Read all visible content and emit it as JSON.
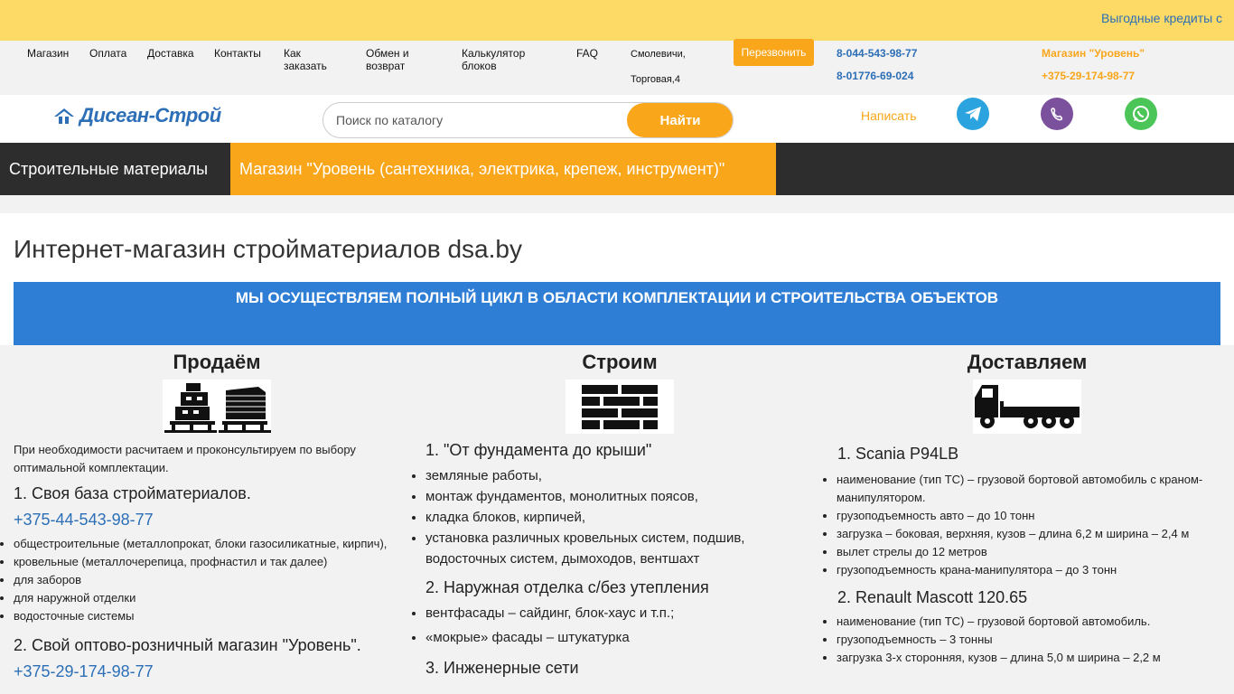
{
  "promo": {
    "text": "Выгодные кредиты с"
  },
  "nav": {
    "items": [
      "Магазин",
      "Оплата",
      "Доставка",
      "Контакты",
      "Как заказать",
      "Обмен и возврат",
      "Калькулятор блоков",
      "FAQ"
    ],
    "address_city": "Смолевичи,",
    "address_street": "Торговая,4",
    "callback_label": "Перезвонить",
    "phone1": "8-044-543-98-77",
    "phone2": "8-01776-69-024",
    "shop_title": "Магазин \"Уровень\"",
    "shop_phone": "+375-29-174-98-77"
  },
  "header": {
    "logo_text": "Дисеан-Строй",
    "search_placeholder": "Поиск по каталогу",
    "search_button": "Найти",
    "write_label": "Написать",
    "socials": [
      "telegram-icon",
      "viber-icon",
      "whatsapp-icon"
    ]
  },
  "categories": {
    "building": "Строительные материалы",
    "shop": "Магазин \"Уровень (сантехника, электрика, крепеж, инструмент)\""
  },
  "main": {
    "title": "Интернет-магазин стройматериалов dsa.by",
    "banner": "МЫ ОСУЩЕСТВЛЯЕМ ПОЛНЫЙ ЦИКЛ В ОБЛАСТИ КОМПЛЕКТАЦИИ И СТРОИТЕЛЬСТВА ОБЪЕКТОВ"
  },
  "sell": {
    "heading": "Продаём",
    "intro": "При необходимости расчитаем и проконсультируем по выбору оптимальной комплектации.",
    "sub1": "1. Своя база стройматериалов.",
    "phone1": "+375-44-543-98-77",
    "items": [
      "общестроительные (металлопрокат, блоки газосиликатные, кирпич),",
      "кровельные (металлочерепица, профнастил и так далее)",
      "для заборов",
      "для наружной отделки",
      "водосточные системы"
    ],
    "sub2": "2. Свой оптово-розничный магазин \"Уровень\".",
    "phone2": "+375-29-174-98-77"
  },
  "build": {
    "heading": "Строим",
    "sub1": "1. \"От фундамента до крыши\"",
    "items1": [
      "земляные работы,",
      "монтаж фундаментов, монолитных поясов,",
      "кладка блоков, кирпичей,",
      "установка различных кровельных систем, подшив, водосточных систем, дымоходов, вентшахт"
    ],
    "sub2": "2. Наружная отделка с/без утепления",
    "items2": [
      "вентфасады – сайдинг, блок-хаус и т.п.;",
      "«мокрые» фасады – штукатурка"
    ],
    "sub3": "3. Инженерные сети"
  },
  "deliver": {
    "heading": "Доставляем",
    "sub1": "1. Scania P94LB",
    "items1": [
      "наименование (тип ТС) – грузовой бортовой автомобиль с краном-манипулятором.",
      "грузоподъемность авто – до 10 тонн",
      "загрузка – боковая, верхняя, кузов – длина 6,2 м ширина – 2,4 м",
      "вылет стрелы до 12 метров",
      "грузоподъемность крана-манипулятора – до 3 тонн"
    ],
    "sub2": "2. Renault Mascott 120.65",
    "items2": [
      "наименование (тип ТС) – грузовой бортовой автомобиль.",
      "грузоподъемность – 3 тонны",
      "загрузка 3-х сторонняя, кузов – длина 5,0 м ширина – 2,2 м"
    ]
  },
  "colors": {
    "accent": "#f9a61a",
    "brand_blue": "#2c6fb7",
    "banner_blue": "#2f7ed6",
    "promo_yellow": "#fdd966",
    "dark": "#2d2d2d"
  }
}
